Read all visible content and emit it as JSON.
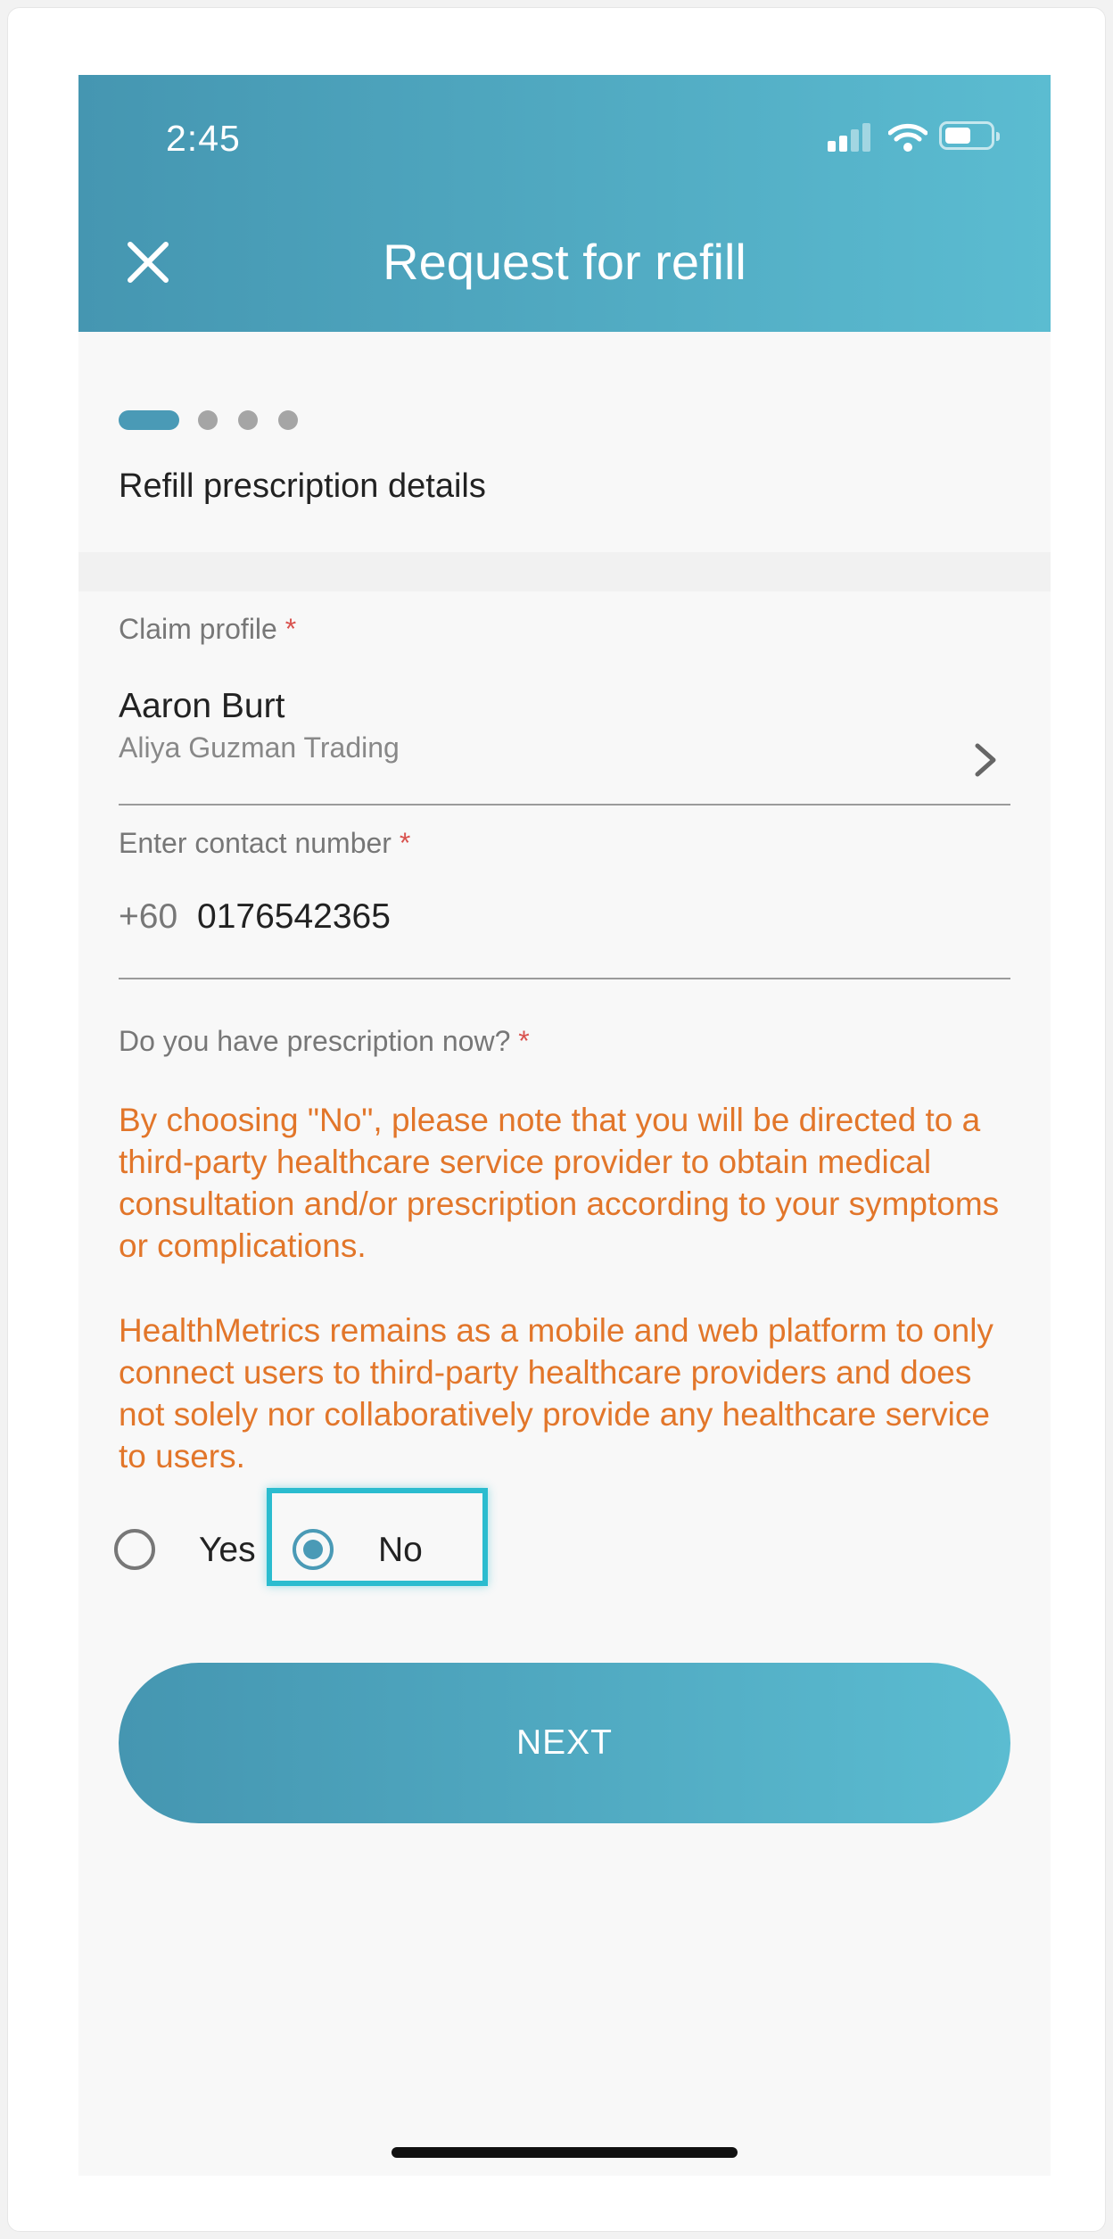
{
  "status_bar": {
    "time": "2:45"
  },
  "header": {
    "title": "Request for refill"
  },
  "progress": {
    "current_step": 1,
    "total_steps": 4
  },
  "section": {
    "title": "Refill prescription details"
  },
  "claim_profile": {
    "label": "Claim profile",
    "required_mark": "*",
    "name": "Aaron Burt",
    "company": "Aliya Guzman Trading"
  },
  "contact": {
    "label": "Enter contact number",
    "required_mark": "*",
    "country_code": "+60",
    "number": "0176542365"
  },
  "prescription_question": {
    "label": "Do you have prescription now?",
    "required_mark": "*",
    "notice_1": "By choosing \"No\", please note that you will be directed to a third-party healthcare service provider to obtain medical consultation and/or prescription according to your symptoms or complications.",
    "notice_2": "HealthMetrics remains as a mobile and web platform to only connect users to third-party healthcare providers and does not solely nor collaboratively provide any healthcare service to users.",
    "options": [
      {
        "label": "Yes",
        "selected": false
      },
      {
        "label": "No",
        "selected": true
      }
    ]
  },
  "next_button": {
    "label": "NEXT"
  },
  "colors": {
    "primary": "#4a9ab6",
    "header_gradient_start": "#4596b1",
    "header_gradient_end": "#5bbcd1",
    "notice": "#e2762a",
    "required": "#d9534f",
    "highlight": "#2bbccf"
  }
}
